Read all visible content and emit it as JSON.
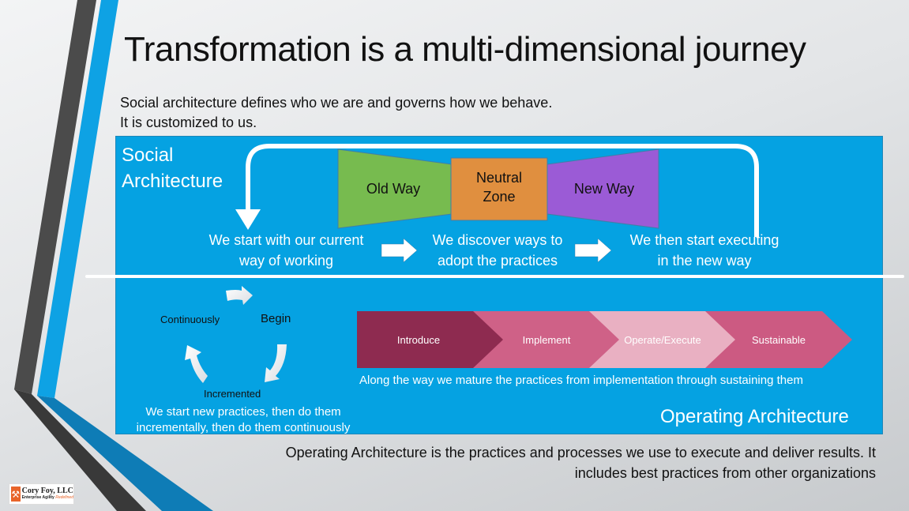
{
  "slide": {
    "title": "Transformation is a multi-dimensional journey",
    "subtitle": "Social architecture defines who we are and governs how we behave. It is customized to us.",
    "footer_text": "Operating Architecture is the practices and processes we use to execute and deliver results. It includes best practices from other organizations"
  },
  "social": {
    "label_line1": "Social",
    "label_line2": "Architecture",
    "transition": {
      "old_way": "Old Way",
      "neutral_line1": "Neutral",
      "neutral_line2": "Zone",
      "new_way": "New Way",
      "colors": {
        "old_way": "#77bb4f",
        "neutral": "#e08f3f",
        "new_way": "#9b5bd6"
      }
    },
    "steps": [
      {
        "line1": "We start with our current",
        "line2": "way of working"
      },
      {
        "line1": "We discover ways to",
        "line2": "adopt the practices"
      },
      {
        "line1": "We then start executing",
        "line2": "in the new way"
      }
    ]
  },
  "operating": {
    "label": "Operating Architecture",
    "cycle": {
      "begin": "Begin",
      "incremented": "Incremented",
      "continuously": "Continuously",
      "description": "We start new practices, then do them incrementally, then do them continuously"
    },
    "maturity": [
      {
        "label": "Introduce",
        "color": "#8e2b50"
      },
      {
        "label": "Implement",
        "color": "#cf6187"
      },
      {
        "label": "Operate/Execute",
        "color": "#e9b0c2"
      },
      {
        "label": "Sustainable",
        "color": "#cc5a82"
      }
    ],
    "maturity_caption": "Along the way we mature the practices from implementation through sustaining them"
  },
  "logo": {
    "name": "Cory Foy, LLC",
    "tagline": "Enterprise Agility",
    "tagline_accent": "Redefined"
  },
  "theme": {
    "panel_blue": "#05a2e2",
    "dark_stripe": "#4a4a4a",
    "blue_stripe": "#0da0e2"
  }
}
